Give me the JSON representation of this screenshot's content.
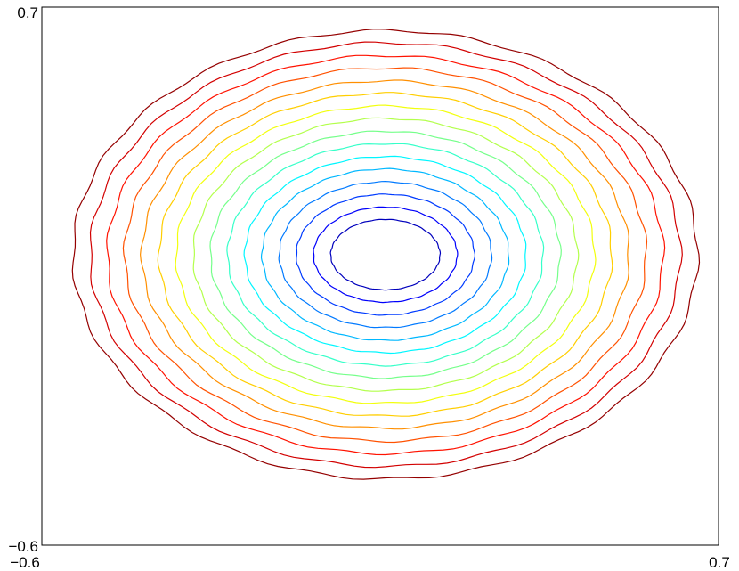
{
  "chart_data": {
    "type": "contour",
    "title": "",
    "xlabel": "",
    "ylabel": "",
    "xlim": [
      -0.6,
      0.7
    ],
    "ylim": [
      -0.6,
      0.7
    ],
    "x_ticks": [
      "−0.6",
      "0.7"
    ],
    "y_ticks": [
      "−0.6",
      "0.7"
    ],
    "grid": false,
    "colormap": "jet",
    "center": [
      0.06,
      0.102
    ],
    "levels": [
      {
        "rx": 0.105,
        "ry": 0.085
      },
      {
        "rx": 0.138,
        "ry": 0.115
      },
      {
        "rx": 0.171,
        "ry": 0.146
      },
      {
        "rx": 0.204,
        "ry": 0.176
      },
      {
        "rx": 0.237,
        "ry": 0.207
      },
      {
        "rx": 0.27,
        "ry": 0.237
      },
      {
        "rx": 0.303,
        "ry": 0.268
      },
      {
        "rx": 0.336,
        "ry": 0.298
      },
      {
        "rx": 0.369,
        "ry": 0.329
      },
      {
        "rx": 0.402,
        "ry": 0.359
      },
      {
        "rx": 0.435,
        "ry": 0.39
      },
      {
        "rx": 0.468,
        "ry": 0.42
      },
      {
        "rx": 0.501,
        "ry": 0.451
      },
      {
        "rx": 0.534,
        "ry": 0.481
      },
      {
        "rx": 0.567,
        "ry": 0.512
      },
      {
        "rx": 0.6,
        "ry": 0.542
      }
    ]
  }
}
